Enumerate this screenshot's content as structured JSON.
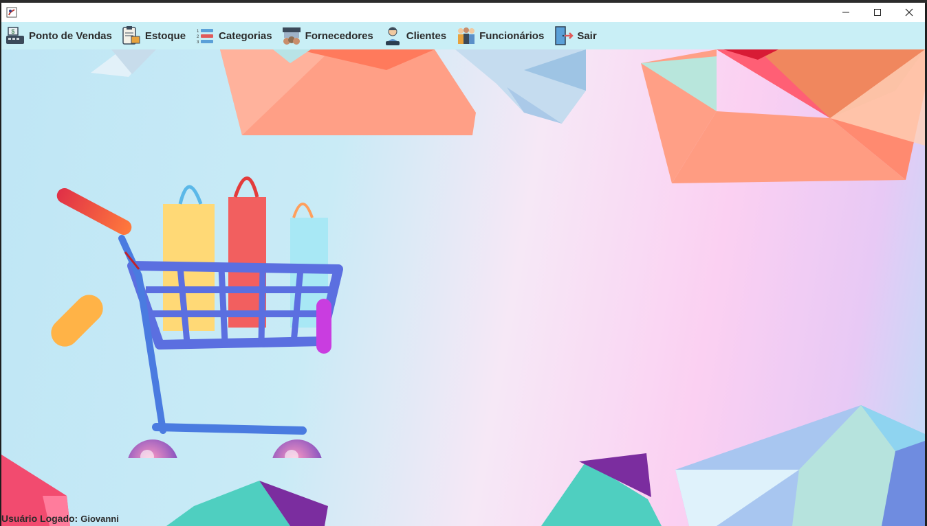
{
  "window": {
    "title": "",
    "controls": {
      "minimize_icon": "minimize-icon",
      "maximize_icon": "maximize-icon",
      "close_icon": "close-icon"
    }
  },
  "menu": {
    "items": [
      {
        "label": "Ponto de Vendas",
        "icon": "cash-register-icon"
      },
      {
        "label": "Estoque",
        "icon": "inventory-clipboard-icon"
      },
      {
        "label": "Categorias",
        "icon": "category-list-icon"
      },
      {
        "label": "Fornecedores",
        "icon": "supplier-store-icon"
      },
      {
        "label": "Clientes",
        "icon": "client-icon"
      },
      {
        "label": "Funcionários",
        "icon": "employees-icon"
      },
      {
        "label": "Sair",
        "icon": "exit-door-icon"
      }
    ]
  },
  "status": {
    "label": "Usuário Logado:",
    "user": "Giovanni"
  },
  "colors": {
    "menubar": "#c9eff6",
    "accent_coral": "#ff8a70",
    "cart_blue": "#5b6fe0"
  }
}
